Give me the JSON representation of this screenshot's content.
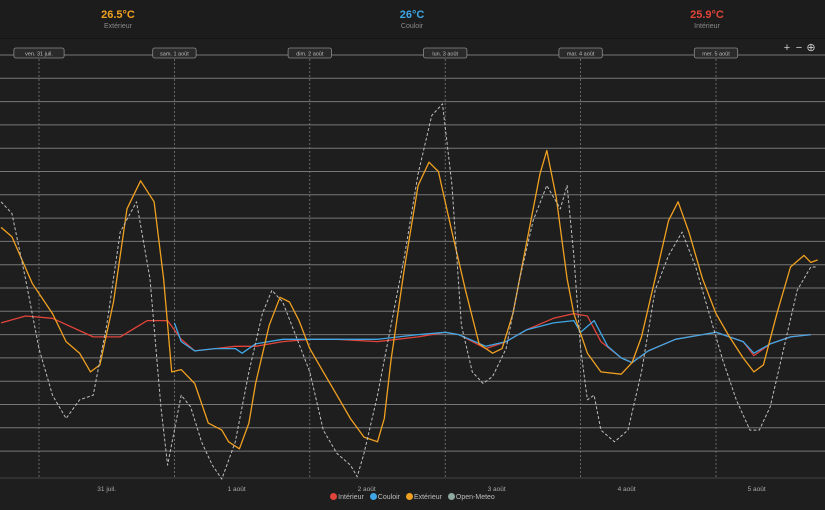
{
  "header": {
    "stats": [
      {
        "value": "26.5°C",
        "label": "Extérieur",
        "color": "#f0a020"
      },
      {
        "value": "26°C",
        "label": "Couloir",
        "color": "#3fa6e6"
      },
      {
        "value": "25.9°C",
        "label": "Intérieur",
        "color": "#e0443a"
      }
    ]
  },
  "toolbar": {
    "zoom_in": "+",
    "zoom_out": "−",
    "zoom_icon": "⊕"
  },
  "chart_data": {
    "type": "line",
    "title": "",
    "grid": true,
    "legend_placement": "bottom",
    "xlabel": "",
    "ylabel": "",
    "day_markers": [
      {
        "label": "ven. 31 juil.",
        "t": 0.0
      },
      {
        "label": "sam. 1 août",
        "t": 1.0
      },
      {
        "label": "dim. 2 août",
        "t": 2.0
      },
      {
        "label": "lun. 3 août",
        "t": 3.0
      },
      {
        "label": "mar. 4 août",
        "t": 4.0
      },
      {
        "label": "mer. 5 août",
        "t": 5.0
      }
    ],
    "x_ticks": [
      {
        "label": "31 juil.",
        "t": 0.5
      },
      {
        "label": "1 août",
        "t": 1.46
      },
      {
        "label": "2 août",
        "t": 2.42
      },
      {
        "label": "3 août",
        "t": 3.38
      },
      {
        "label": "4 août",
        "t": 4.34
      },
      {
        "label": "5 août",
        "t": 5.3
      }
    ],
    "series": [
      {
        "name": "Intérieur",
        "color": "#e0443a",
        "dashed": false,
        "points": [
          [
            -0.28,
            26.1
          ],
          [
            -0.1,
            26.4
          ],
          [
            0.1,
            26.3
          ],
          [
            0.4,
            25.5
          ],
          [
            0.6,
            25.5
          ],
          [
            0.8,
            26.2
          ],
          [
            0.95,
            26.2
          ],
          [
            1.05,
            25.4
          ],
          [
            1.15,
            24.9
          ],
          [
            1.3,
            25.0
          ],
          [
            1.45,
            25.1
          ],
          [
            1.6,
            25.1
          ],
          [
            1.8,
            25.3
          ],
          [
            2.0,
            25.4
          ],
          [
            2.2,
            25.4
          ],
          [
            2.5,
            25.3
          ],
          [
            2.8,
            25.5
          ],
          [
            3.0,
            25.7
          ],
          [
            3.1,
            25.6
          ],
          [
            3.3,
            25.0
          ],
          [
            3.45,
            25.3
          ],
          [
            3.6,
            25.8
          ],
          [
            3.8,
            26.3
          ],
          [
            3.95,
            26.5
          ],
          [
            4.05,
            26.4
          ],
          [
            4.15,
            25.3
          ],
          [
            4.3,
            24.6
          ],
          [
            4.38,
            24.4
          ],
          [
            4.5,
            24.9
          ],
          [
            4.7,
            25.4
          ],
          [
            4.9,
            25.6
          ],
          [
            5.0,
            25.7
          ],
          [
            5.2,
            25.3
          ],
          [
            5.28,
            24.7
          ],
          [
            5.4,
            25.2
          ],
          [
            5.55,
            25.5
          ],
          [
            5.7,
            25.6
          ]
        ]
      },
      {
        "name": "Couloir",
        "color": "#3fa6e6",
        "dashed": false,
        "points": [
          [
            1.0,
            26.1
          ],
          [
            1.05,
            25.3
          ],
          [
            1.15,
            24.9
          ],
          [
            1.3,
            25.0
          ],
          [
            1.45,
            25.0
          ],
          [
            1.5,
            24.8
          ],
          [
            1.6,
            25.2
          ],
          [
            1.8,
            25.4
          ],
          [
            2.0,
            25.4
          ],
          [
            2.2,
            25.4
          ],
          [
            2.5,
            25.4
          ],
          [
            2.8,
            25.6
          ],
          [
            3.0,
            25.7
          ],
          [
            3.1,
            25.6
          ],
          [
            3.3,
            25.1
          ],
          [
            3.45,
            25.3
          ],
          [
            3.6,
            25.8
          ],
          [
            3.8,
            26.1
          ],
          [
            3.95,
            26.2
          ],
          [
            4.0,
            25.7
          ],
          [
            4.1,
            26.2
          ],
          [
            4.2,
            25.1
          ],
          [
            4.3,
            24.6
          ],
          [
            4.38,
            24.4
          ],
          [
            4.5,
            24.9
          ],
          [
            4.7,
            25.4
          ],
          [
            4.9,
            25.6
          ],
          [
            5.0,
            25.7
          ],
          [
            5.2,
            25.3
          ],
          [
            5.28,
            24.8
          ],
          [
            5.4,
            25.2
          ],
          [
            5.55,
            25.5
          ],
          [
            5.7,
            25.6
          ]
        ]
      },
      {
        "name": "Extérieur",
        "color": "#f0a020",
        "dashed": false,
        "points": [
          [
            -0.28,
            30.2
          ],
          [
            -0.2,
            29.8
          ],
          [
            -0.05,
            27.8
          ],
          [
            0.1,
            26.5
          ],
          [
            0.2,
            25.3
          ],
          [
            0.3,
            24.8
          ],
          [
            0.38,
            24.0
          ],
          [
            0.45,
            24.3
          ],
          [
            0.55,
            27.0
          ],
          [
            0.65,
            31.0
          ],
          [
            0.75,
            32.2
          ],
          [
            0.85,
            31.3
          ],
          [
            0.92,
            28.0
          ],
          [
            0.98,
            24.0
          ],
          [
            1.05,
            24.1
          ],
          [
            1.15,
            23.5
          ],
          [
            1.25,
            21.8
          ],
          [
            1.35,
            21.5
          ],
          [
            1.4,
            21.0
          ],
          [
            1.48,
            20.7
          ],
          [
            1.55,
            21.8
          ],
          [
            1.6,
            23.5
          ],
          [
            1.7,
            26.0
          ],
          [
            1.78,
            27.2
          ],
          [
            1.85,
            27.0
          ],
          [
            1.92,
            26.2
          ],
          [
            2.0,
            25.0
          ],
          [
            2.1,
            24.0
          ],
          [
            2.2,
            23.0
          ],
          [
            2.3,
            22.0
          ],
          [
            2.4,
            21.2
          ],
          [
            2.5,
            21.0
          ],
          [
            2.55,
            22.0
          ],
          [
            2.6,
            24.5
          ],
          [
            2.7,
            28.5
          ],
          [
            2.8,
            32.0
          ],
          [
            2.88,
            33.0
          ],
          [
            2.95,
            32.6
          ],
          [
            3.05,
            30.0
          ],
          [
            3.15,
            27.5
          ],
          [
            3.25,
            25.2
          ],
          [
            3.35,
            24.8
          ],
          [
            3.42,
            25.0
          ],
          [
            3.5,
            26.5
          ],
          [
            3.6,
            29.5
          ],
          [
            3.7,
            32.5
          ],
          [
            3.75,
            33.5
          ],
          [
            3.82,
            31.5
          ],
          [
            3.9,
            28.0
          ],
          [
            3.95,
            26.5
          ],
          [
            4.05,
            24.8
          ],
          [
            4.15,
            24.0
          ],
          [
            4.3,
            23.9
          ],
          [
            4.38,
            24.4
          ],
          [
            4.45,
            25.5
          ],
          [
            4.55,
            28.0
          ],
          [
            4.65,
            30.5
          ],
          [
            4.72,
            31.3
          ],
          [
            4.8,
            30.0
          ],
          [
            4.9,
            28.0
          ],
          [
            5.0,
            26.5
          ],
          [
            5.1,
            25.5
          ],
          [
            5.2,
            24.6
          ],
          [
            5.28,
            24.0
          ],
          [
            5.35,
            24.3
          ],
          [
            5.45,
            26.5
          ],
          [
            5.55,
            28.5
          ],
          [
            5.65,
            29.0
          ],
          [
            5.7,
            28.7
          ],
          [
            5.75,
            28.8
          ]
        ]
      },
      {
        "name": "Open-Meteo",
        "color": "#bdbdbd",
        "dashed": true,
        "points": [
          [
            -0.28,
            31.3
          ],
          [
            -0.2,
            30.8
          ],
          [
            -0.1,
            28.0
          ],
          [
            0.0,
            25.0
          ],
          [
            0.1,
            23.0
          ],
          [
            0.2,
            22.0
          ],
          [
            0.3,
            22.8
          ],
          [
            0.4,
            23.0
          ],
          [
            0.5,
            26.0
          ],
          [
            0.6,
            30.0
          ],
          [
            0.72,
            31.3
          ],
          [
            0.82,
            28.0
          ],
          [
            0.9,
            22.5
          ],
          [
            0.95,
            20.0
          ],
          [
            1.0,
            21.5
          ],
          [
            1.05,
            23.0
          ],
          [
            1.12,
            22.5
          ],
          [
            1.2,
            21.0
          ],
          [
            1.28,
            20.0
          ],
          [
            1.35,
            19.4
          ],
          [
            1.45,
            21.0
          ],
          [
            1.55,
            24.0
          ],
          [
            1.65,
            26.5
          ],
          [
            1.72,
            27.5
          ],
          [
            1.8,
            27.0
          ],
          [
            1.9,
            25.5
          ],
          [
            2.0,
            24.0
          ],
          [
            2.1,
            21.5
          ],
          [
            2.2,
            20.5
          ],
          [
            2.3,
            20.0
          ],
          [
            2.35,
            19.5
          ],
          [
            2.4,
            20.5
          ],
          [
            2.5,
            23.0
          ],
          [
            2.6,
            26.0
          ],
          [
            2.7,
            29.0
          ],
          [
            2.8,
            32.5
          ],
          [
            2.9,
            35.0
          ],
          [
            2.98,
            35.5
          ],
          [
            3.05,
            32.0
          ],
          [
            3.12,
            26.0
          ],
          [
            3.2,
            24.0
          ],
          [
            3.28,
            23.5
          ],
          [
            3.35,
            23.8
          ],
          [
            3.45,
            25.0
          ],
          [
            3.55,
            28.0
          ],
          [
            3.65,
            30.5
          ],
          [
            3.75,
            32.0
          ],
          [
            3.85,
            31.0
          ],
          [
            3.9,
            32.0
          ],
          [
            3.95,
            29.0
          ],
          [
            4.0,
            25.0
          ],
          [
            4.05,
            22.8
          ],
          [
            4.1,
            23.0
          ],
          [
            4.15,
            21.5
          ],
          [
            4.25,
            21.0
          ],
          [
            4.35,
            21.5
          ],
          [
            4.45,
            24.0
          ],
          [
            4.55,
            27.5
          ],
          [
            4.65,
            29.0
          ],
          [
            4.75,
            30.0
          ],
          [
            4.85,
            28.5
          ],
          [
            4.95,
            26.5
          ],
          [
            5.05,
            24.5
          ],
          [
            5.15,
            22.8
          ],
          [
            5.25,
            21.5
          ],
          [
            5.32,
            21.5
          ],
          [
            5.4,
            22.5
          ],
          [
            5.5,
            25.0
          ],
          [
            5.6,
            27.5
          ],
          [
            5.7,
            28.5
          ],
          [
            5.75,
            28.5
          ]
        ]
      }
    ]
  }
}
